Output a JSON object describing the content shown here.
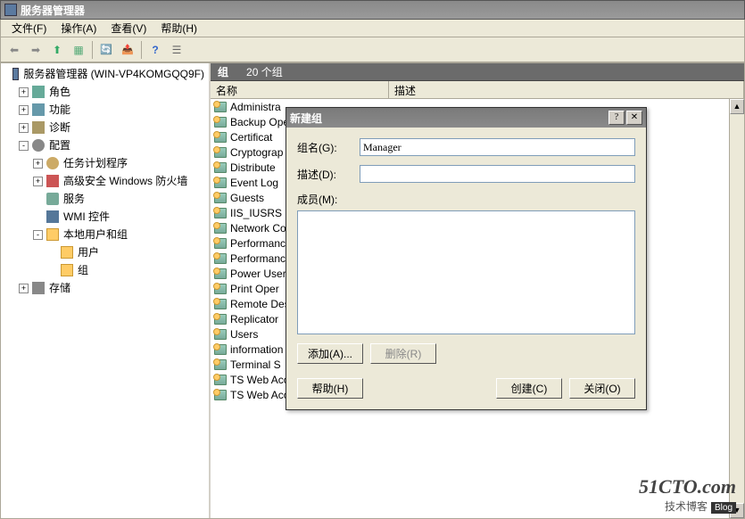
{
  "window": {
    "title": "服务器管理器"
  },
  "menu": {
    "file": "文件(F)",
    "action": "操作(A)",
    "view": "查看(V)",
    "help": "帮助(H)"
  },
  "tree": {
    "root": "服务器管理器 (WIN-VP4KOMGQQ9F)",
    "roles": "角色",
    "features": "功能",
    "diagnostics": "诊断",
    "configuration": "配置",
    "task_scheduler": "任务计划程序",
    "firewall": "高级安全 Windows 防火墙",
    "services": "服务",
    "wmi": "WMI 控件",
    "local_users_groups": "本地用户和组",
    "users": "用户",
    "groups": "组",
    "storage": "存储"
  },
  "rightpane": {
    "header_title": "组",
    "header_count": "20 个组",
    "col_name": "名称",
    "col_desc": "描述",
    "items": [
      "Administra",
      "Backup Ope",
      "Certificat",
      "Cryptograp",
      "Distribute",
      "Event Log",
      "Guests",
      "IIS_IUSRS",
      "Network Co",
      "Performanc",
      "Performanc",
      "Power User",
      "Print Oper",
      "Remote Des",
      "Replicator",
      "Users",
      "information",
      "Terminal S",
      "TS Web Acc",
      "TS Web Acc"
    ]
  },
  "dialog": {
    "title": "新建组",
    "name_label": "组名(G):",
    "name_value": "Manager",
    "desc_label": "描述(D):",
    "desc_value": "",
    "members_label": "成员(M):",
    "btn_add": "添加(A)...",
    "btn_remove": "删除(R)",
    "btn_help": "帮助(H)",
    "btn_create": "创建(C)",
    "btn_close": "关闭(O)"
  },
  "watermark": {
    "brand": "51CTO.com",
    "sub": "技术博客",
    "badge": "Blog"
  }
}
